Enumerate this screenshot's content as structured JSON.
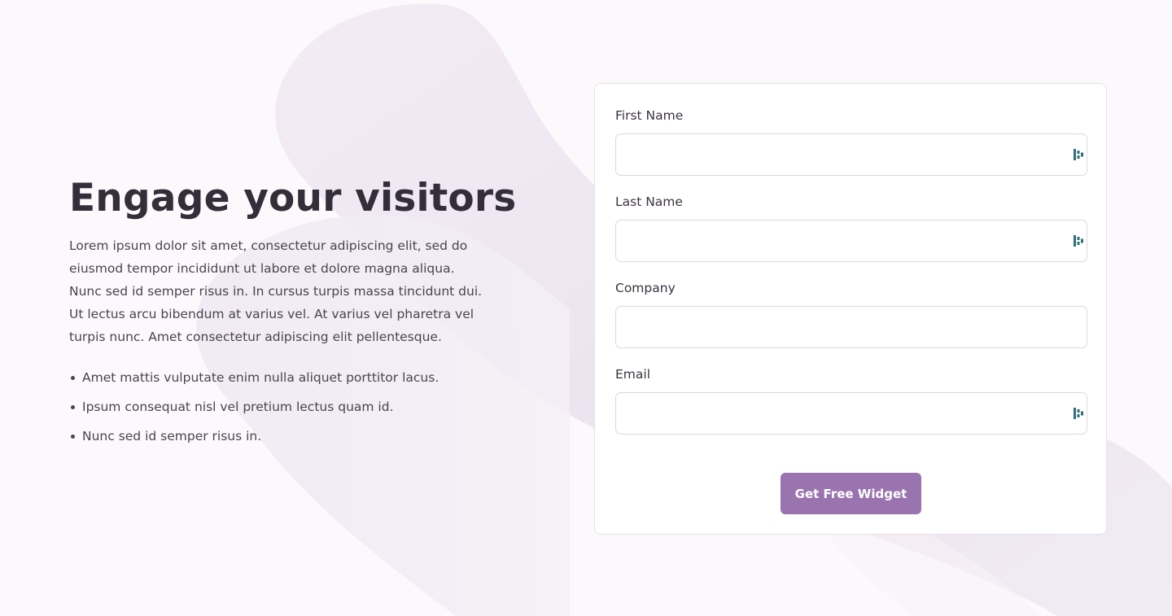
{
  "hero": {
    "headline": "Engage your visitors",
    "intro": "Lorem ipsum dolor sit amet, consectetur adipiscing elit, sed do eiusmod tempor incididunt ut labore et dolore magna aliqua. Nunc sed id semper risus in. In cursus turpis massa tincidunt dui. Ut lectus arcu bibendum at varius vel. At varius vel pharetra vel turpis nunc. Amet consectetur adipiscing elit pellentesque.",
    "features": [
      "Amet mattis vulputate enim nulla aliquet porttitor lacus.",
      "Ipsum consequat nisl vel pretium lectus quam id.",
      "Nunc sed id semper risus in."
    ]
  },
  "form": {
    "fields": [
      {
        "label": "First Name",
        "value": "",
        "has_autofill_icon": true
      },
      {
        "label": "Last Name",
        "value": "",
        "has_autofill_icon": true
      },
      {
        "label": "Company",
        "value": "",
        "has_autofill_icon": false
      },
      {
        "label": "Email",
        "value": "",
        "has_autofill_icon": true
      }
    ],
    "submit_label": "Get Free Widget"
  },
  "colors": {
    "accent": "#9a74ae",
    "heading": "#342e3b",
    "body_text": "#4a4351",
    "background": "#fcf9fc",
    "autofill_icon": "#2f6e7a"
  },
  "icons": {
    "autofill": "password-manager-icon"
  }
}
